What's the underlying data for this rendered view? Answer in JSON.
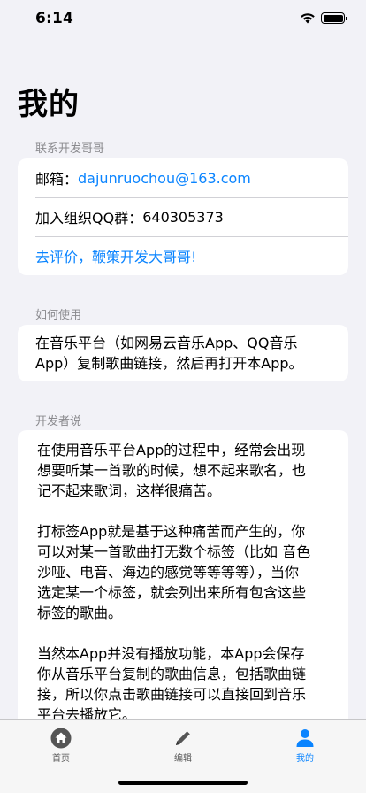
{
  "status_bar": {
    "time": "6:14"
  },
  "page_title": "我的",
  "contact_section": {
    "header": "联系开发哥哥",
    "email_label": "邮箱：",
    "email_value": "dajunruochou@163.com",
    "qq_label": "加入组织QQ群：",
    "qq_value": "640305373",
    "review_link": "去评价，鞭策开发大哥哥!"
  },
  "usage_section": {
    "header": "如何使用",
    "lines": [
      "在音乐平台（如网易云音乐App、QQ音乐",
      "App）复制歌曲链接，然后再打开本App。"
    ]
  },
  "dev_section": {
    "header": "开发者说",
    "paragraphs": [
      [
        "在使用音乐平台App的过程中，经常会出现",
        "想要听某一首歌的时候，想不起来歌名，也",
        "记不起来歌词，这样很痛苦。"
      ],
      [
        "打标签App就是基于这种痛苦而产生的，你",
        "可以对某一首歌曲打无数个标签（比如 音色",
        "沙哑、电音、海边的感觉等等等等），当你",
        "选定某一个标签，就会列出来所有包含这些",
        "标签的歌曲。"
      ],
      [
        "当然本App并没有播放功能，本App会保存",
        "你从音乐平台复制的歌曲信息，包括歌曲链",
        "接，所以你点击歌曲链接可以直接回到音乐",
        "平台去播放它。"
      ]
    ]
  },
  "tab_bar": {
    "tabs": [
      {
        "label": "首页",
        "icon": "home-icon",
        "active": false
      },
      {
        "label": "编辑",
        "icon": "pencil-icon",
        "active": false
      },
      {
        "label": "我的",
        "icon": "person-icon",
        "active": true
      }
    ],
    "accent_color": "#0a84ff"
  }
}
